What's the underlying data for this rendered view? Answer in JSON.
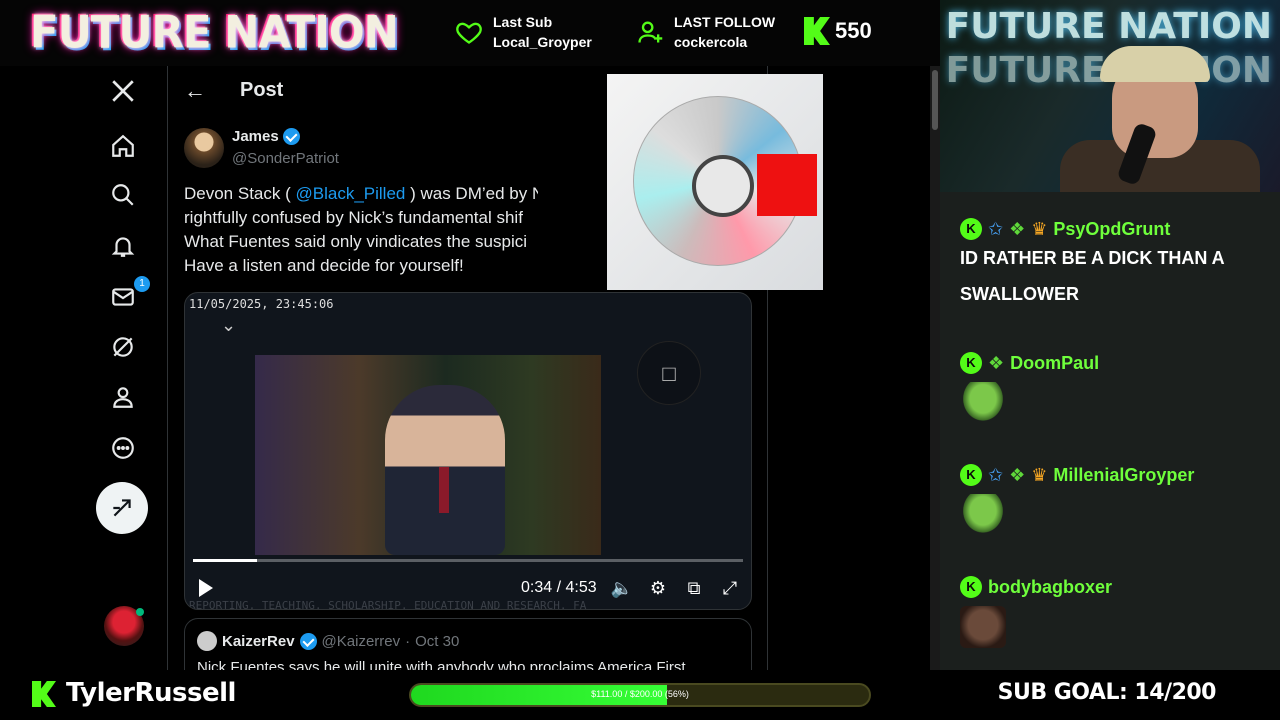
{
  "overlay": {
    "brand": "FUTURE NATION",
    "last_sub_label": "Last Sub",
    "last_sub_name": "Local_Groyper",
    "last_follow_label": "LAST FOLLOW",
    "last_follow_name": "cockercola",
    "viewer_count": "550",
    "accent": "#53fc18"
  },
  "x": {
    "header_title": "Post",
    "mail_badge": "1",
    "post": {
      "author_name": "James",
      "author_handle": "@SonderPatriot",
      "text_before_mention": "Devon Stack ( ",
      "mention": "@Black_Pilled",
      "text_after_mention": " ) was DM’ed by N",
      "line2": "rightfully confused by Nick’s fundamental shif",
      "line3": "What Fuentes said only vindicates the suspici",
      "line4": "Have a listen and decide for yourself!"
    },
    "video": {
      "timestamp": "11/05/2025, 23:45:06",
      "time": "0:34 / 4:53",
      "progress": 0.117,
      "ticker": "REPORTING, TEACHING, SCHOLARSHIP, EDUCATION AND RESEARCH. FA"
    },
    "quote": {
      "name": "KaizerRev",
      "handle": "@Kaizerrev",
      "date": "Oct 30",
      "text": "Nick Fuentes says he will unite with anybody who proclaims America First."
    }
  },
  "webcam": {
    "brand": "FUTURE NATION"
  },
  "chat": {
    "messages": [
      {
        "user": "PsyOpdGrunt",
        "text": "ID RATHER BE A DICK THAN A SWALLOWER"
      },
      {
        "user": "DoomPaul",
        "emote": "frog-emote"
      },
      {
        "user": "MillenialGroyper",
        "emote": "frog-emote"
      },
      {
        "user": "bodybagboxer",
        "emote": "face-emote"
      }
    ]
  },
  "bottom": {
    "streamer": "TylerRussell",
    "goal_text": "$111.00 / $200.00 (56%)",
    "goal_fraction": 0.56,
    "sub_goal": "SUB GOAL: 14/200"
  }
}
